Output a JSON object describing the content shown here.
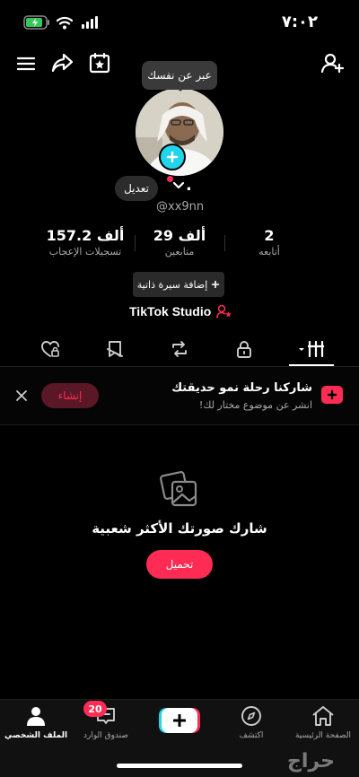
{
  "status_bar": {
    "time": "٧:٠٢"
  },
  "profile": {
    "bubble": "عبر عن نفسك",
    "edit": "تعديل",
    "name_suffix": ".",
    "handle": "@xx9nn",
    "stats": [
      {
        "value": "157.2 ألف",
        "label": "تسجيلات الإعجاب"
      },
      {
        "value": "29 ألف",
        "label": "متابعين"
      },
      {
        "value": "2",
        "label": "أتابعه"
      }
    ],
    "add_bio": "إضافة سيرة ذاتية",
    "studio": "TikTok Studio"
  },
  "banner": {
    "title": "شاركنا رحلة نمو حديقتك",
    "subtitle": "انشر عن موضوع مختار لك!",
    "button": "إنشاء"
  },
  "empty_state": {
    "title": "شارك صورتك الأكثر شعبية",
    "button": "تحميل"
  },
  "nav": {
    "profile": "الملف الشخصي",
    "inbox": "صندوق الوارد",
    "inbox_badge": "20",
    "discover": "اكتشف",
    "home": "الصفحة الرئيسية"
  },
  "watermark": "حراج",
  "colors": {
    "accent": "#fe2c55",
    "blue": "#20d5ec",
    "muted": "#a8a8a8"
  }
}
